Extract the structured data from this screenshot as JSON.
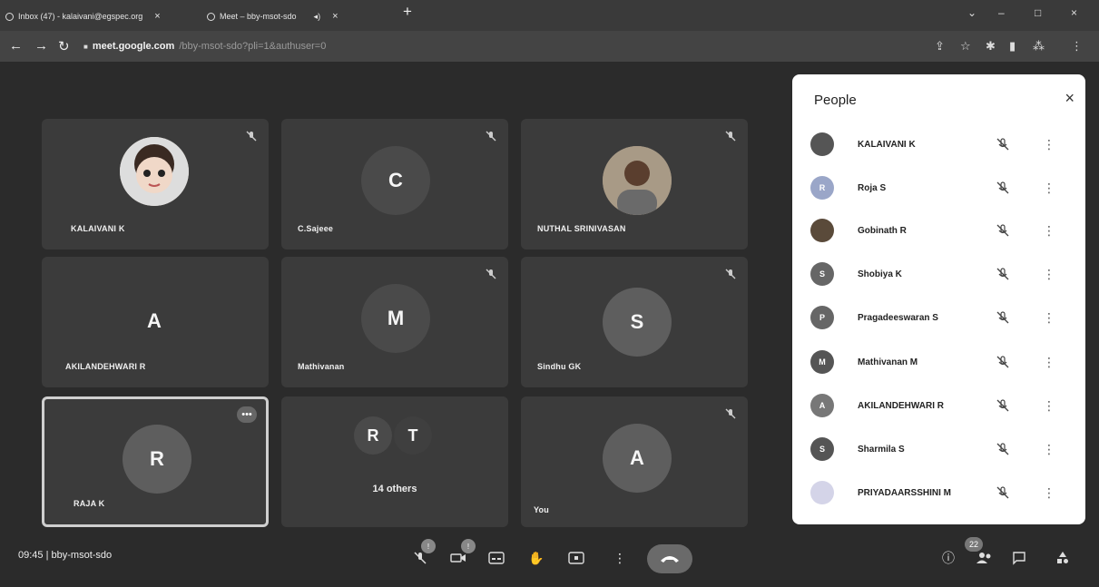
{
  "browser": {
    "tabs": [
      {
        "label": "Inbox (47) - kalaivani@egspec.org",
        "close": "×"
      },
      {
        "label": "Meet – bby-msot-sdo",
        "close": "×"
      }
    ],
    "new_tab": "+",
    "window_controls": {
      "minimize": "–",
      "restore": "□",
      "close": "×"
    },
    "nav": {
      "back": "←",
      "forward": "→",
      "reload": "↻"
    },
    "url": {
      "host": "meet.google.com",
      "path": "/bby-msot-sdo?pli=1&authuser=0"
    }
  },
  "tiles": [
    {
      "name": "KALAIVANI K",
      "type": "photo-doll",
      "muted": true
    },
    {
      "name": "C.Sajeee",
      "letter": "C",
      "muted": true
    },
    {
      "name": "NUTHAL SRINIVASAN",
      "type": "photo-man",
      "muted": true
    },
    {
      "name": "AKILANDEHWARI R",
      "letter": "A",
      "muted": false
    },
    {
      "name": "Mathivanan",
      "letter": "M",
      "muted": true
    },
    {
      "name": "Sindhu GK",
      "letter": "S",
      "muted": true
    },
    {
      "name": "RAJA K",
      "letter": "R",
      "selected": true,
      "more": "•••"
    },
    {
      "letters": [
        "R",
        "T"
      ],
      "others_label": "14 others"
    },
    {
      "name": "You",
      "letter": "A",
      "muted": true
    }
  ],
  "bottom_bar": {
    "time": "09:45",
    "separator": "|",
    "meeting_code": "bby-msot-sdo",
    "mic_badge": "!",
    "cam_badge": "!",
    "people_count": "22",
    "icons": [
      "mic-off-icon",
      "camera-off-icon",
      "captions-icon",
      "raise-hand-icon",
      "present-icon",
      "more-icon",
      "end-call-icon",
      "info-icon",
      "people-icon",
      "chat-icon",
      "activities-icon"
    ]
  },
  "people_panel": {
    "title": "People",
    "close": "×",
    "participants": [
      {
        "name": "KALAIVANI K",
        "initial": "",
        "color": "#555555"
      },
      {
        "name": "Roja S",
        "initial": "R",
        "color": "#9aa6c8"
      },
      {
        "name": "Gobinath R",
        "initial": "",
        "color": "#5a4a3a"
      },
      {
        "name": "Shobiya K",
        "initial": "S",
        "color": "#666666"
      },
      {
        "name": "Pragadeeswaran S",
        "initial": "P",
        "color": "#666666"
      },
      {
        "name": "Mathivanan M",
        "initial": "M",
        "color": "#555555"
      },
      {
        "name": "AKILANDEHWARI R",
        "initial": "A",
        "color": "#777777"
      },
      {
        "name": "Sharmila S",
        "initial": "S",
        "color": "#555555"
      },
      {
        "name": "PRIYADAARSSHINI M",
        "initial": "",
        "color": "#d4d4e8"
      }
    ]
  }
}
